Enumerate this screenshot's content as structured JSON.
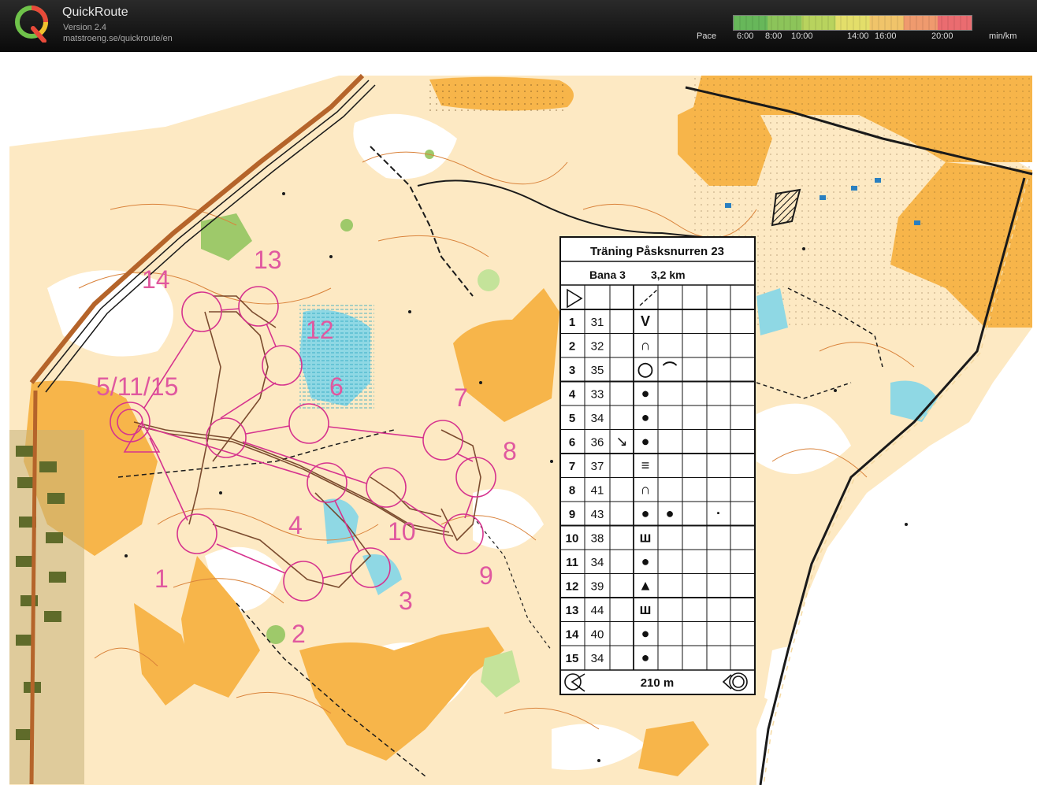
{
  "app": {
    "name": "QuickRoute",
    "version": "Version 2.4",
    "url": "matstroeng.se/quickroute/en",
    "logo_letter": "Q"
  },
  "pace_legend": {
    "label": "Pace",
    "ticks": [
      "6:00",
      "8:00",
      "10:00",
      "14:00",
      "16:00",
      "20:00"
    ],
    "unit": "min/km",
    "colors": [
      "#67b75a",
      "#8cc45a",
      "#b8d35e",
      "#e3de6a",
      "#f0c46a",
      "#ef9a6e",
      "#ea6c70"
    ]
  },
  "map": {
    "colors": {
      "paper": "#ffffff",
      "open": "#f7b54a",
      "semi_open": "#fde9c3",
      "water": "#7fd3e0",
      "green": "#9ec96a",
      "contour": "#d9823a",
      "course": "#d6338e",
      "route": "#6e3b1f",
      "black": "#1a1a1a"
    },
    "control_numbers": [
      {
        "label": "14"
      },
      {
        "label": "13"
      },
      {
        "label": "12"
      },
      {
        "label": "5/11/15"
      },
      {
        "label": "6"
      },
      {
        "label": "7"
      },
      {
        "label": "8"
      },
      {
        "label": "4"
      },
      {
        "label": "10"
      },
      {
        "label": "1"
      },
      {
        "label": "9"
      },
      {
        "label": "3"
      },
      {
        "label": "2"
      }
    ]
  },
  "description_sheet": {
    "title": "Träning  Påsksnurren 23",
    "course": "Bana 3",
    "length": "3,2 km",
    "rows": [
      {
        "n": "1",
        "code": "31",
        "symbol": "V",
        "extra": ""
      },
      {
        "n": "2",
        "code": "32",
        "symbol": "∩",
        "extra": ""
      },
      {
        "n": "3",
        "code": "35",
        "symbol": "◯",
        "extra": "⌒"
      },
      {
        "n": "4",
        "code": "33",
        "symbol": "●",
        "extra": ""
      },
      {
        "n": "5",
        "code": "34",
        "symbol": "●",
        "extra": ""
      },
      {
        "n": "6",
        "code": "36",
        "symbol": "●",
        "extra": "↘"
      },
      {
        "n": "7",
        "code": "37",
        "symbol": "≡",
        "extra": ""
      },
      {
        "n": "8",
        "code": "41",
        "symbol": "∩",
        "extra": ""
      },
      {
        "n": "9",
        "code": "43",
        "symbol": "●",
        "extra": "●",
        "extra2": "·"
      },
      {
        "n": "10",
        "code": "38",
        "symbol": "ш",
        "extra": ""
      },
      {
        "n": "11",
        "code": "34",
        "symbol": "●",
        "extra": ""
      },
      {
        "n": "12",
        "code": "39",
        "symbol": "▲",
        "extra": ""
      },
      {
        "n": "13",
        "code": "44",
        "symbol": "ш",
        "extra": ""
      },
      {
        "n": "14",
        "code": "40",
        "symbol": "●",
        "extra": ""
      },
      {
        "n": "15",
        "code": "34",
        "symbol": "●",
        "extra": ""
      }
    ],
    "finish": "210 m"
  }
}
